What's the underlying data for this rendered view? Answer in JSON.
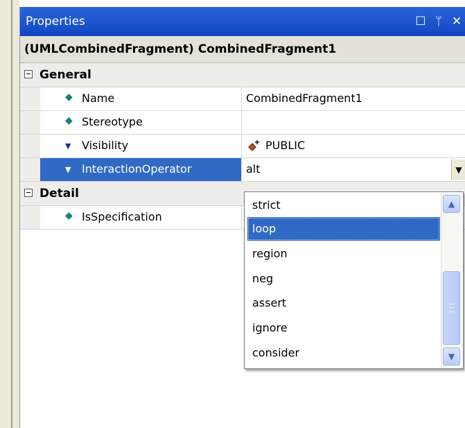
{
  "window": {
    "title": "Properties"
  },
  "title_icons": [
    "restore-icon",
    "pin-icon",
    "close-icon"
  ],
  "selected_object": "(UMLCombinedFragment) CombinedFragment1",
  "categories": [
    {
      "label": "General",
      "properties": [
        {
          "name": "Name",
          "value": "CombinedFragment1"
        },
        {
          "name": "Stereotype",
          "value": ""
        },
        {
          "name": "Visibility",
          "value": "PUBLIC"
        },
        {
          "name": "InteractionOperator",
          "value": "alt"
        }
      ]
    },
    {
      "label": "Detail",
      "properties": [
        {
          "name": "IsSpecification",
          "value": ""
        }
      ]
    }
  ],
  "dropdown": {
    "options": [
      "strict",
      "loop",
      "region",
      "neg",
      "assert",
      "ignore",
      "consider"
    ],
    "highlighted": "loop"
  },
  "colors": {
    "titlebar": "#1a52cf",
    "selection": "#316ac5",
    "diamond_icon": "#1a7f7a"
  }
}
